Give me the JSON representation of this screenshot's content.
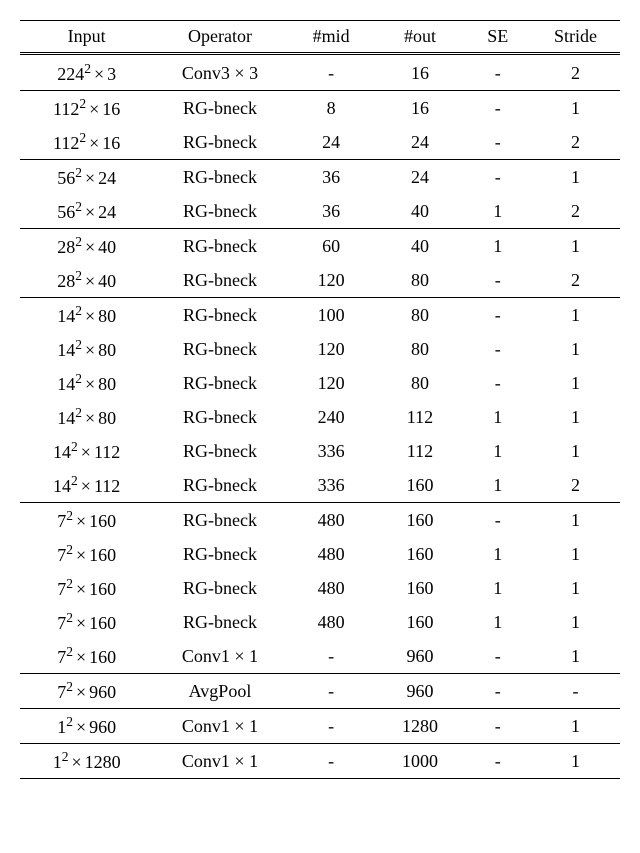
{
  "headers": {
    "input": "Input",
    "operator": "Operator",
    "mid": "#mid",
    "out": "#out",
    "se": "SE",
    "stride": "Stride"
  },
  "chart_data": {
    "type": "table",
    "columns": [
      "Input",
      "Operator",
      "#mid",
      "#out",
      "SE",
      "Stride"
    ],
    "groups": [
      {
        "rows": [
          {
            "in_base": 224,
            "in_ch": 3,
            "op": "Conv3 × 3",
            "mid": "-",
            "out": 16,
            "se": "-",
            "st": 2
          }
        ]
      },
      {
        "rows": [
          {
            "in_base": 112,
            "in_ch": 16,
            "op": "RG-bneck",
            "mid": 8,
            "out": 16,
            "se": "-",
            "st": 1
          },
          {
            "in_base": 112,
            "in_ch": 16,
            "op": "RG-bneck",
            "mid": 24,
            "out": 24,
            "se": "-",
            "st": 2
          }
        ]
      },
      {
        "rows": [
          {
            "in_base": 56,
            "in_ch": 24,
            "op": "RG-bneck",
            "mid": 36,
            "out": 24,
            "se": "-",
            "st": 1
          },
          {
            "in_base": 56,
            "in_ch": 24,
            "op": "RG-bneck",
            "mid": 36,
            "out": 40,
            "se": 1,
            "st": 2
          }
        ]
      },
      {
        "rows": [
          {
            "in_base": 28,
            "in_ch": 40,
            "op": "RG-bneck",
            "mid": 60,
            "out": 40,
            "se": 1,
            "st": 1
          },
          {
            "in_base": 28,
            "in_ch": 40,
            "op": "RG-bneck",
            "mid": 120,
            "out": 80,
            "se": "-",
            "st": 2
          }
        ]
      },
      {
        "rows": [
          {
            "in_base": 14,
            "in_ch": 80,
            "op": "RG-bneck",
            "mid": 100,
            "out": 80,
            "se": "-",
            "st": 1
          },
          {
            "in_base": 14,
            "in_ch": 80,
            "op": "RG-bneck",
            "mid": 120,
            "out": 80,
            "se": "-",
            "st": 1
          },
          {
            "in_base": 14,
            "in_ch": 80,
            "op": "RG-bneck",
            "mid": 120,
            "out": 80,
            "se": "-",
            "st": 1
          },
          {
            "in_base": 14,
            "in_ch": 80,
            "op": "RG-bneck",
            "mid": 240,
            "out": 112,
            "se": 1,
            "st": 1
          },
          {
            "in_base": 14,
            "in_ch": 112,
            "op": "RG-bneck",
            "mid": 336,
            "out": 112,
            "se": 1,
            "st": 1
          },
          {
            "in_base": 14,
            "in_ch": 112,
            "op": "RG-bneck",
            "mid": 336,
            "out": 160,
            "se": 1,
            "st": 2
          }
        ]
      },
      {
        "rows": [
          {
            "in_base": 7,
            "in_ch": 160,
            "op": "RG-bneck",
            "mid": 480,
            "out": 160,
            "se": "-",
            "st": 1
          },
          {
            "in_base": 7,
            "in_ch": 160,
            "op": "RG-bneck",
            "mid": 480,
            "out": 160,
            "se": 1,
            "st": 1
          },
          {
            "in_base": 7,
            "in_ch": 160,
            "op": "RG-bneck",
            "mid": 480,
            "out": 160,
            "se": 1,
            "st": 1
          },
          {
            "in_base": 7,
            "in_ch": 160,
            "op": "RG-bneck",
            "mid": 480,
            "out": 160,
            "se": 1,
            "st": 1
          },
          {
            "in_base": 7,
            "in_ch": 160,
            "op": "Conv1 × 1",
            "mid": "-",
            "out": 960,
            "se": "-",
            "st": 1
          }
        ]
      },
      {
        "rows": [
          {
            "in_base": 7,
            "in_ch": 960,
            "op": "AvgPool",
            "mid": "-",
            "out": 960,
            "se": "-",
            "st": "-"
          }
        ]
      },
      {
        "rows": [
          {
            "in_base": 1,
            "in_ch": 960,
            "op": "Conv1 × 1",
            "mid": "-",
            "out": 1280,
            "se": "-",
            "st": 1
          }
        ]
      },
      {
        "rows": [
          {
            "in_base": 1,
            "in_ch": 1280,
            "op": "Conv1 × 1",
            "mid": "-",
            "out": 1000,
            "se": "-",
            "st": 1
          }
        ]
      }
    ]
  }
}
